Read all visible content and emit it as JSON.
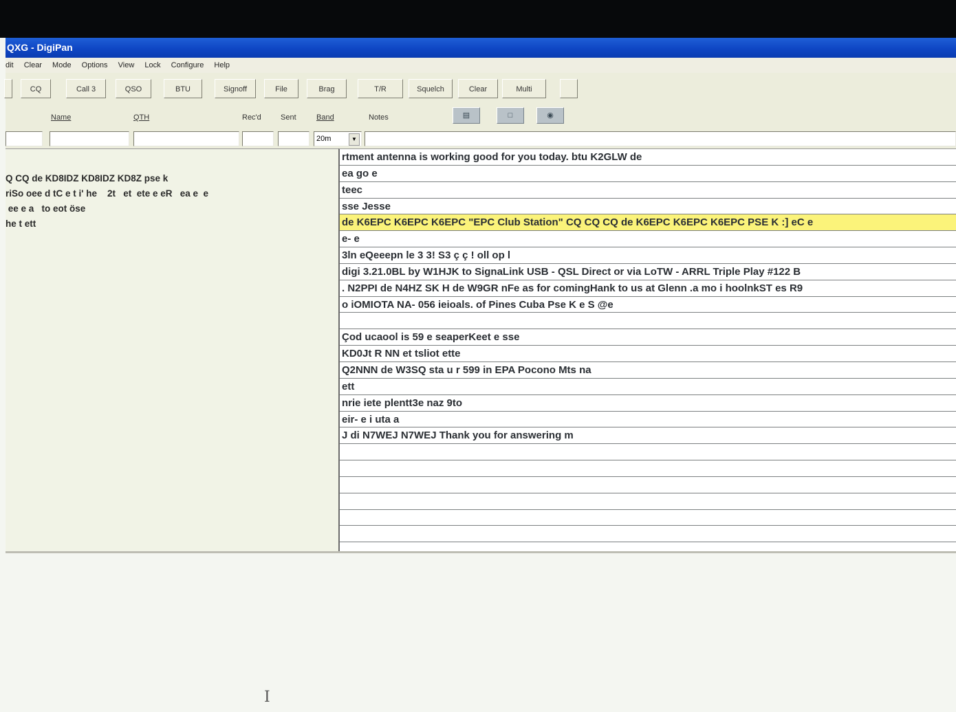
{
  "window": {
    "title": "QXG - DigiPan"
  },
  "menu": [
    "dit",
    "Clear",
    "Mode",
    "Options",
    "View",
    "Lock",
    "Configure",
    "Help"
  ],
  "toolbar": [
    "CQ",
    "Call 3",
    "QSO",
    "BTU",
    "Signoff",
    "File",
    "Brag",
    "T/R",
    "Squelch",
    "Clear",
    "Multi"
  ],
  "fields": {
    "name_label": "Name",
    "qth_label": "QTH",
    "recd_label": "Rec'd",
    "sent_label": "Sent",
    "band_label": "Band",
    "notes_label": "Notes",
    "band_value": "20m"
  },
  "transmit_text": [
    "Q CQ de KD8IDZ KD8IDZ KD8Z pse k",
    "riSo oee d tC e t i' he    2t   et  ete e eR   ea e  e",
    " ee e a   to eot öse",
    "he t ett"
  ],
  "receive_lines": [
    "rtment antenna is working good for you today. btu K2GLW de",
    " ea go e",
    " teec",
    "sse Jesse",
    "de K6EPC K6EPC K6EPC \"EPC Club Station\" CQ CQ CQ de K6EPC K6EPC K6EPC PSE K :] eC e",
    "e- e",
    " 3ln eQeeepn le 3 3! S3 ç ç ! oll op l",
    "digi 3.21.0BL by W1HJK to SignaLink USB - QSL Direct or via LoTW - ARRL Triple Play #122 B",
    ". N2PPI de N4HZ SK H de W9GR nFe as for comingHank to us at Glenn .a mo i hoolnkST es R9",
    "o iOMIOTA NA- 056 ieioals. of Pines Cuba Pse K e S @e",
    "",
    "Çod ucaool is 59 e seaperKeet e sse",
    " KD0Jt R NN et tsliot ette",
    "Q2NNN de W3SQ sta u r 599 in EPA Pocono Mts na",
    "ett",
    " nrie iete plentt3e naz 9to",
    " eir- e i uta a",
    "J di N7WEJ N7WEJ Thank you for answering m",
    "",
    "",
    "",
    "",
    "",
    ""
  ],
  "highlight_index": 4
}
